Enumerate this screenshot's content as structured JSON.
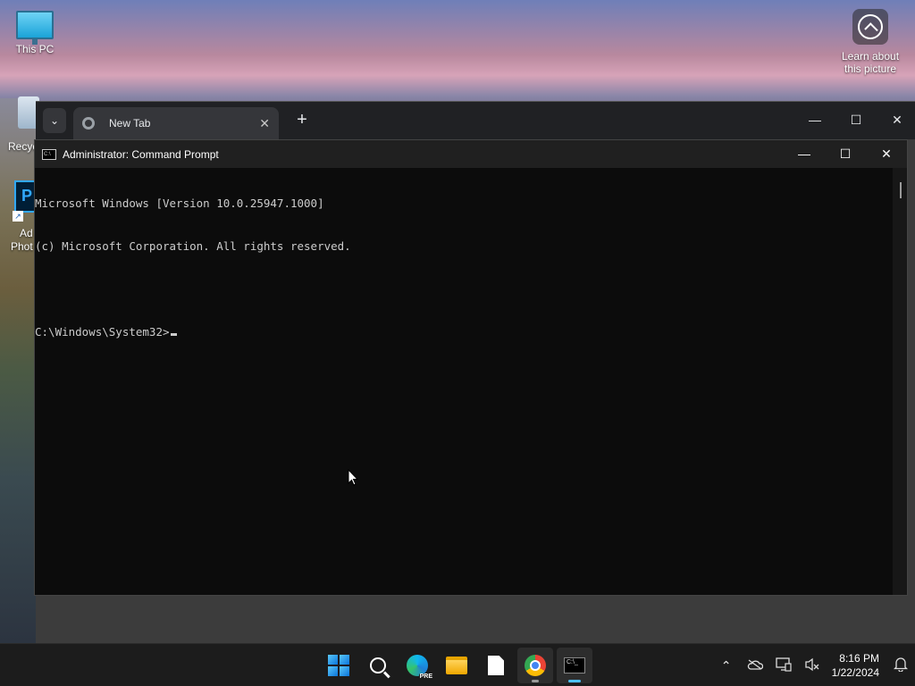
{
  "desktop": {
    "icons": [
      {
        "label": "This PC"
      },
      {
        "label": "Recyc"
      },
      {
        "label_line1": "Ad",
        "label_line2": "Phot"
      }
    ],
    "learn_picture": {
      "line1": "Learn about",
      "line2": "this picture"
    }
  },
  "browser": {
    "tab_title": "New Tab",
    "new_tab_glyph": "+",
    "tab_close_glyph": "✕",
    "tab_dropdown_glyph": "⌄",
    "controls": {
      "minimize": "—",
      "maximize": "☐",
      "close": "✕"
    }
  },
  "cmd": {
    "title": "Administrator: Command Prompt",
    "icon_text": "C:\\",
    "controls": {
      "minimize": "—",
      "maximize": "☐",
      "close": "✕"
    },
    "lines": [
      "Microsoft Windows [Version 10.0.25947.1000]",
      "(c) Microsoft Corporation. All rights reserved.",
      "",
      "C:\\Windows\\System32>"
    ]
  },
  "taskbar": {
    "items": [
      {
        "name": "start",
        "icon": "windows-start-icon"
      },
      {
        "name": "search",
        "icon": "search-icon"
      },
      {
        "name": "edge-preview",
        "icon": "edge-icon",
        "badge": "PRE"
      },
      {
        "name": "file-explorer",
        "icon": "folder-icon"
      },
      {
        "name": "notepad",
        "icon": "file-icon"
      },
      {
        "name": "chrome",
        "icon": "chrome-icon"
      },
      {
        "name": "terminal",
        "icon": "terminal-icon",
        "badge": "C:\\_"
      }
    ],
    "tray": {
      "chevron": "⌃",
      "time": "8:16 PM",
      "date": "1/22/2024"
    }
  }
}
